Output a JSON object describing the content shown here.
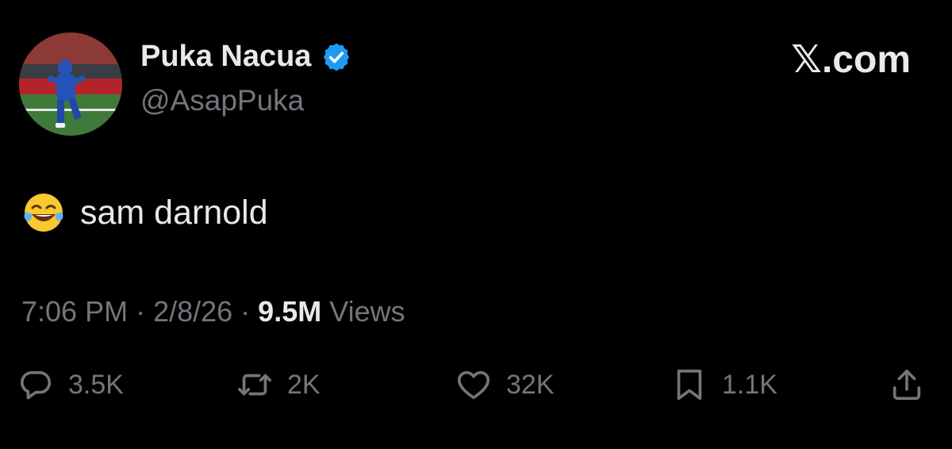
{
  "user": {
    "display_name": "Puka Nacua",
    "handle": "@AsapPuka",
    "verified_icon": "verified-badge-icon"
  },
  "brand": {
    "label": "𝕏.com"
  },
  "tweet": {
    "emoji_icon": "face-with-tears-of-joy-icon",
    "text": "sam darnold"
  },
  "meta": {
    "time": "7:06 PM",
    "sep1": " · ",
    "date": "2/8/26",
    "sep2": " · ",
    "views_count": "9.5M",
    "views_label": " Views"
  },
  "actions": {
    "replies": {
      "icon": "reply-icon",
      "count": "3.5K"
    },
    "reposts": {
      "icon": "repost-icon",
      "count": "2K"
    },
    "likes": {
      "icon": "heart-icon",
      "count": "32K"
    },
    "bookmarks": {
      "icon": "bookmark-icon",
      "count": "1.1K"
    },
    "share": {
      "icon": "share-icon"
    }
  },
  "colors": {
    "background": "#000000",
    "primary_text": "#e7e9ea",
    "secondary_text": "#71767b",
    "verified_blue": "#1d9bf0"
  }
}
